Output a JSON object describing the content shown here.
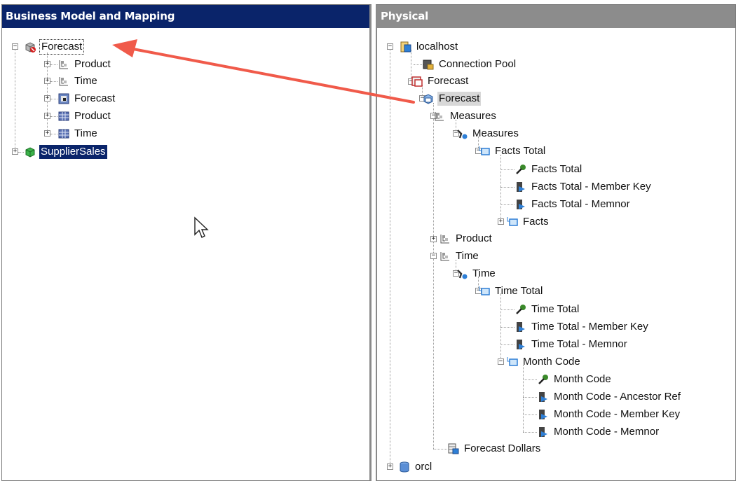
{
  "left_panel": {
    "title": "Business Model and Mapping",
    "items": {
      "forecast_model": "Forecast",
      "product_dim": "Product",
      "time_dim": "Time",
      "forecast_table": "Forecast",
      "product_table": "Product",
      "time_table": "Time",
      "supplier_sales": "SupplierSales"
    }
  },
  "right_panel": {
    "title": "Physical",
    "items": {
      "localhost": "localhost",
      "connection_pool": "Connection Pool",
      "forecast_db": "Forecast",
      "forecast_catalog": "Forecast",
      "measures_dim": "Measures",
      "measures_hier": "Measures",
      "facts_total": "Facts Total",
      "facts_total_key": "Facts Total",
      "facts_total_member_key": "Facts Total - Member Key",
      "facts_total_memnor": "Facts Total - Memnor",
      "facts": "Facts",
      "product": "Product",
      "time_dim": "Time",
      "time_hier": "Time",
      "time_total": "Time Total",
      "time_total_key": "Time Total",
      "time_total_member_key": "Time Total - Member Key",
      "time_total_memnor": "Time Total - Memnor",
      "month_code": "Month Code",
      "month_code_key": "Month Code",
      "month_code_ancestor": "Month Code - Ancestor Ref",
      "month_code_member_key": "Month Code - Member Key",
      "month_code_memnor": "Month Code - Memnor",
      "forecast_dollars": "Forecast Dollars",
      "orcl": "orcl"
    }
  },
  "colors": {
    "left_header": "#0a246a",
    "right_header": "#8c8c8c",
    "arrow": "#f05a4a"
  }
}
